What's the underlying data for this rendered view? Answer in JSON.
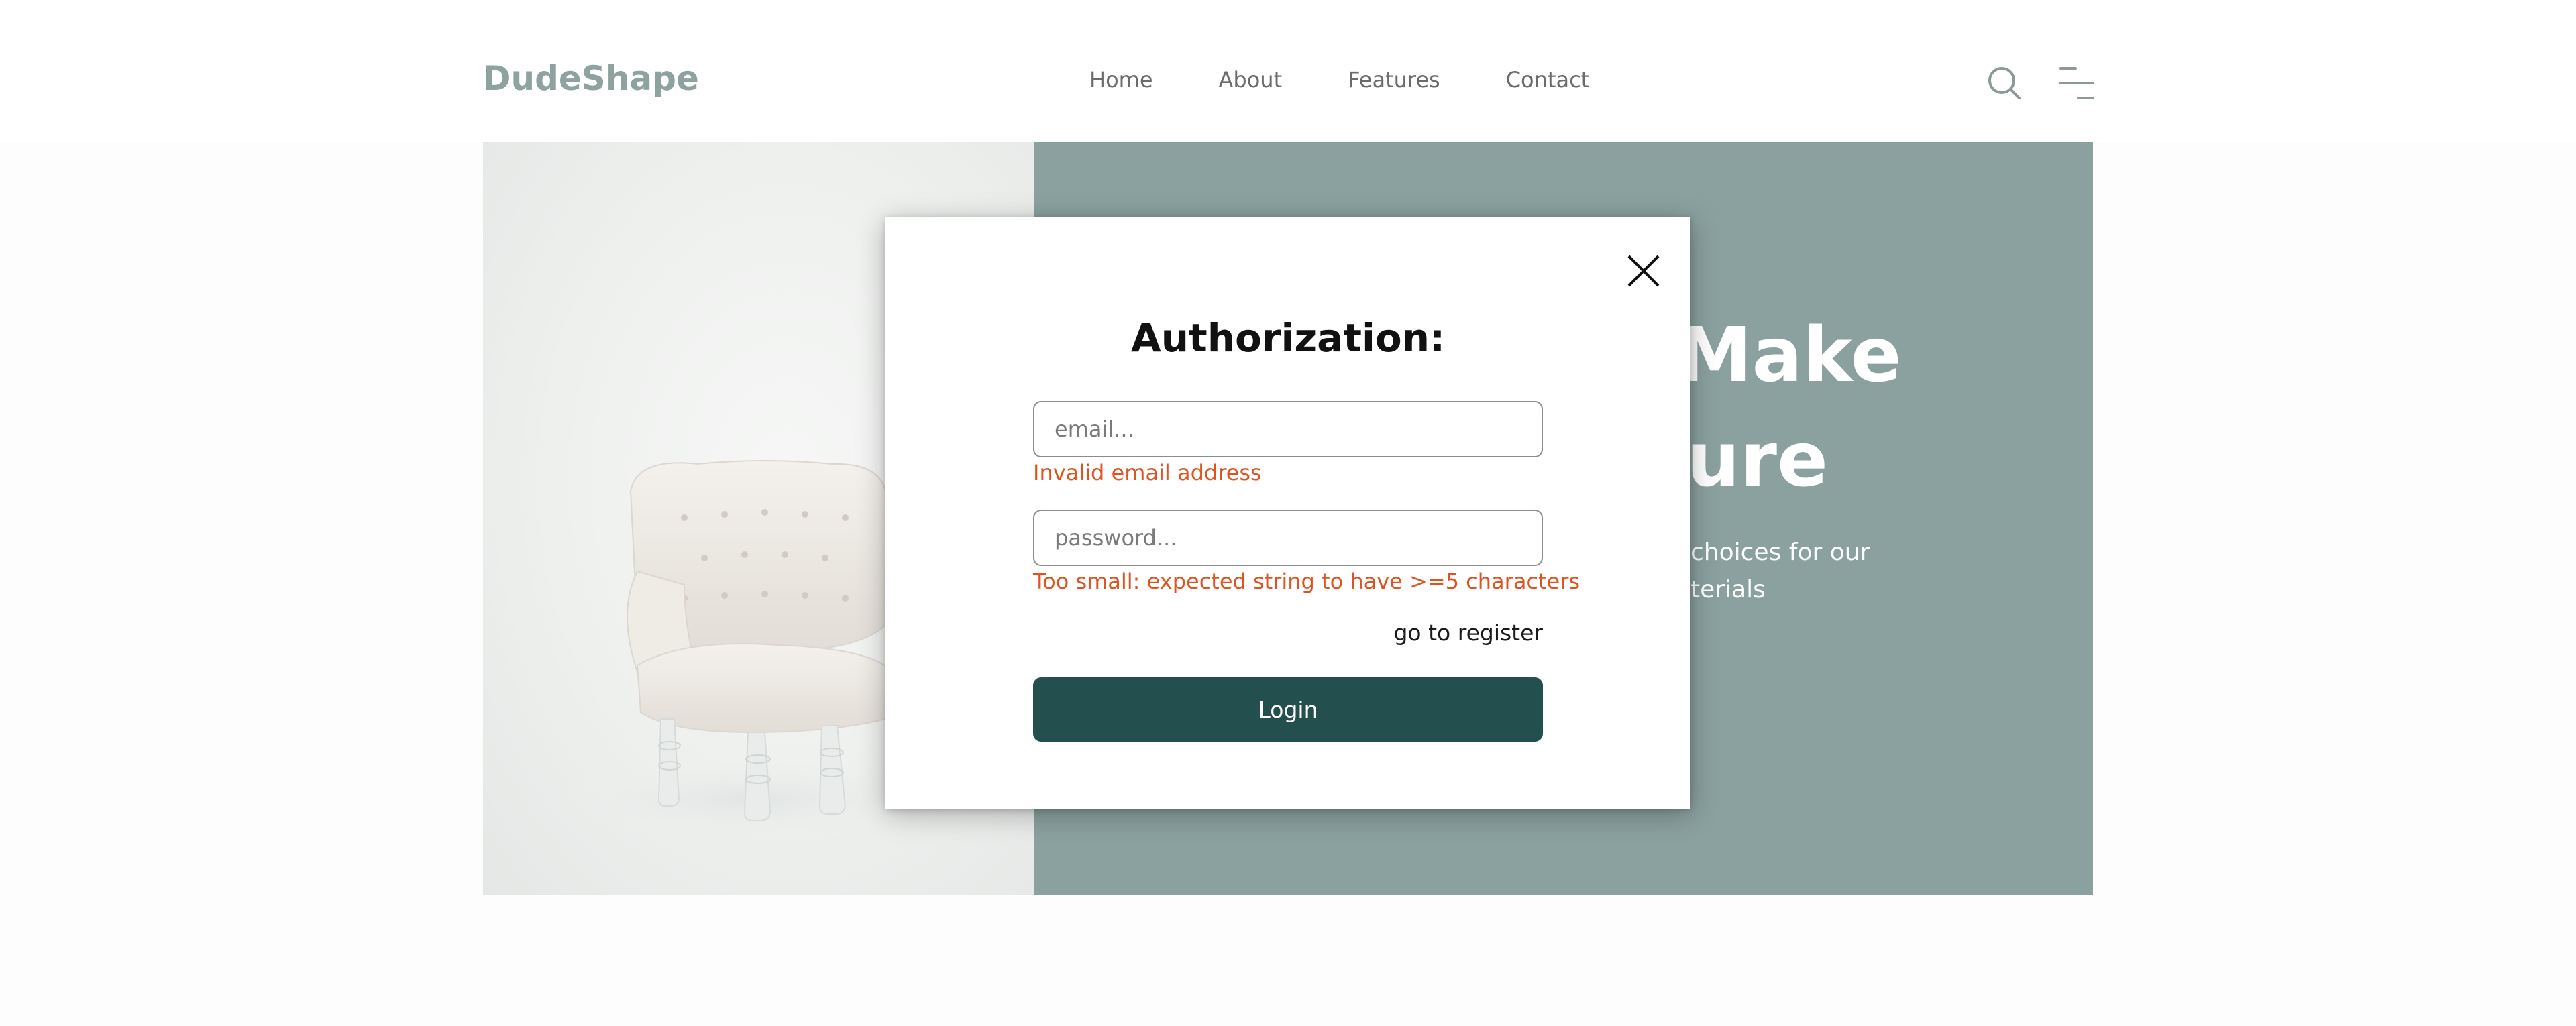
{
  "header": {
    "logo": "DudeShape",
    "nav": [
      {
        "label": "Home"
      },
      {
        "label": "About"
      },
      {
        "label": "Features"
      },
      {
        "label": "Contact"
      }
    ]
  },
  "hero": {
    "title_line1": "Make",
    "title_line2": "ure",
    "subtitle_line1": "choices for our",
    "subtitle_line2": "terials"
  },
  "modal": {
    "title": "Authorization:",
    "email_placeholder": "email...",
    "email_error": "Invalid email address",
    "password_placeholder": "password...",
    "password_error": "Too small: expected string to have >=5 characters",
    "register_link": "go to register",
    "login_label": "Login"
  },
  "colors": {
    "logo": "#8ea29f",
    "hero_panel": "#8aa19f",
    "error": "#e2521f",
    "primary_button": "#234f4e"
  },
  "icons": {
    "search": "search-icon",
    "menu": "menu-icon",
    "close": "close-icon"
  }
}
